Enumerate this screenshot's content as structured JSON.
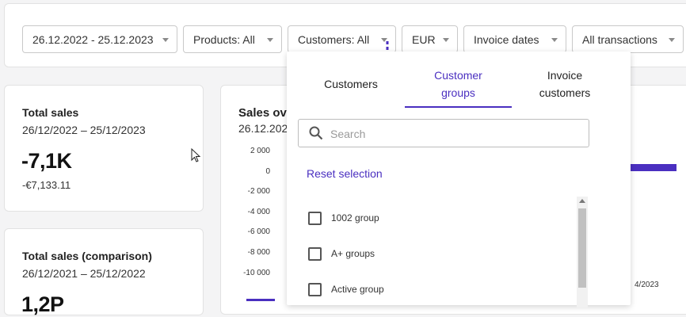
{
  "filters": {
    "date_range": "26.12.2022 - 25.12.2023",
    "products": "Products: All",
    "customers": "Customers: All",
    "currency": "EUR",
    "invoice_dates": "Invoice dates",
    "transactions": "All transactions"
  },
  "total_sales": {
    "title": "Total sales",
    "period": "26/12/2022 – 25/12/2023",
    "value": "-7,1K",
    "detail": "-€7,133.11"
  },
  "comparison": {
    "title": "Total sales (comparison)",
    "period": "26/12/2021 – 25/12/2022",
    "value": "1,2P"
  },
  "chart": {
    "title": "Sales ov",
    "subtitle": "26.12.202",
    "xlabel_partial": "4/2023"
  },
  "chart_data": {
    "type": "bar",
    "yticks": [
      "2 000",
      "0",
      "-2 000",
      "-4 000",
      "-6 000",
      "-8 000",
      "-10 000"
    ],
    "ylim": [
      -10000,
      2000
    ],
    "grid": false
  },
  "dropdown": {
    "tabs": [
      {
        "label": "Customers"
      },
      {
        "label": "Customer groups"
      },
      {
        "label": "Invoice customers"
      }
    ],
    "search_placeholder": "Search",
    "reset_label": "Reset selection",
    "items": [
      {
        "label": "1002 group",
        "checked": false
      },
      {
        "label": "A+ groups",
        "checked": false
      },
      {
        "label": "Active group",
        "checked": false
      }
    ]
  },
  "colors": {
    "accent": "#4a2fc0",
    "bar": "#4a2fc0"
  },
  "icons": {
    "search": "search-icon",
    "pointer": "mouse-pointer-icon",
    "chevron": "chevron-down-icon"
  }
}
